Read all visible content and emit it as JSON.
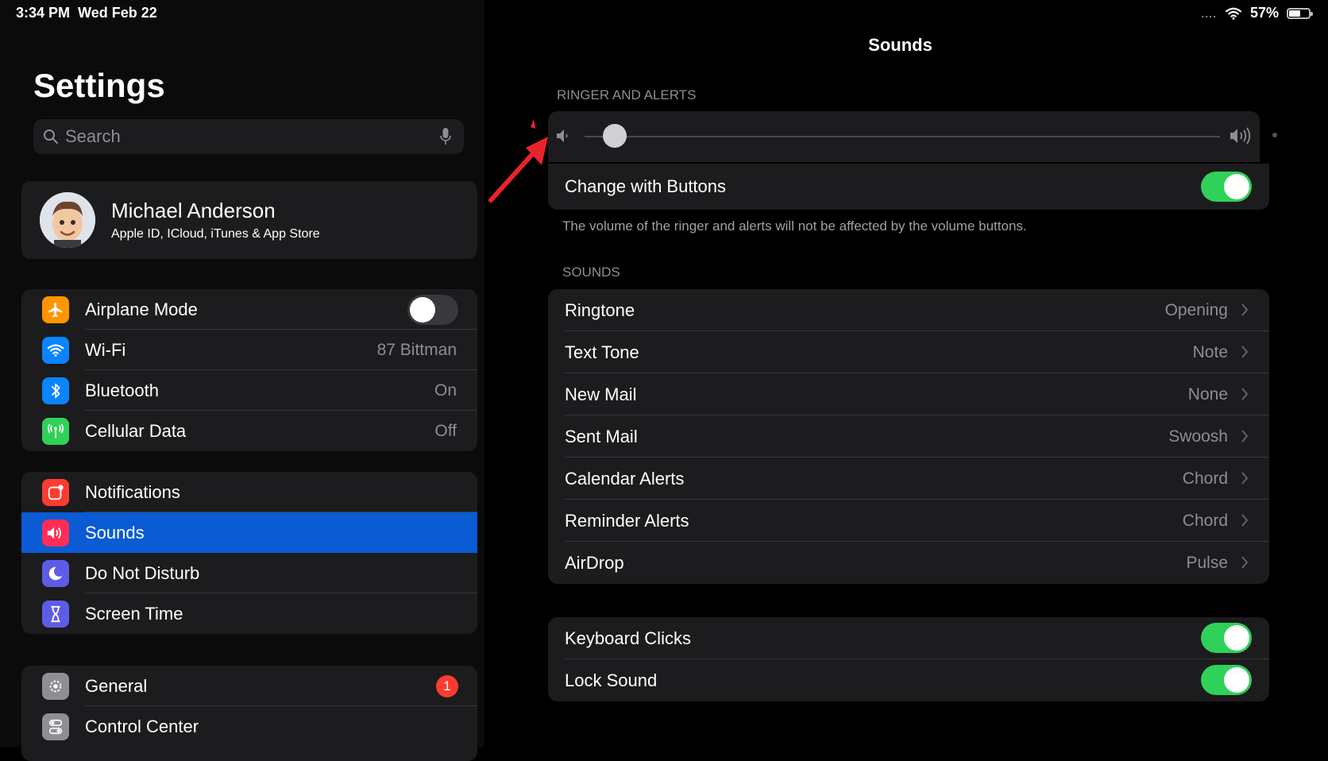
{
  "status_bar": {
    "time": "3:34 PM",
    "date": "Wed Feb 22",
    "dots": "....",
    "battery": "57%",
    "battery_level": 0.57
  },
  "sidebar": {
    "title": "Settings",
    "search_placeholder": "Search",
    "profile": {
      "name": "Michael Anderson",
      "subtitle": "Apple ID, ICloud, iTunes & App Store"
    },
    "group1": [
      {
        "label": "Airplane Mode",
        "icon": "airplane-icon",
        "color": "#ff9500",
        "toggle": false
      },
      {
        "label": "Wi-Fi",
        "value": "87 Bittman",
        "icon": "wifi-icon",
        "color": "#0a84ff"
      },
      {
        "label": "Bluetooth",
        "value": "On",
        "icon": "bluetooth-icon",
        "color": "#0a84ff"
      },
      {
        "label": "Cellular Data",
        "value": "Off",
        "icon": "antenna-icon",
        "color": "#30d158"
      }
    ],
    "group2": [
      {
        "label": "Notifications",
        "icon": "notifications-icon",
        "color": "#ff3b30"
      },
      {
        "label": "Sounds",
        "icon": "speaker-icon",
        "color": "#ff2d55",
        "selected": true
      },
      {
        "label": "Do Not Disturb",
        "icon": "moon-icon",
        "color": "#5e5ce6"
      },
      {
        "label": "Screen Time",
        "icon": "hourglass-icon",
        "color": "#5e5ce6"
      }
    ],
    "group3": [
      {
        "label": "General",
        "icon": "gear-icon",
        "color": "#8e8e93",
        "badge": "1"
      },
      {
        "label": "Control Center",
        "icon": "switches-icon",
        "color": "#8e8e93"
      }
    ]
  },
  "detail": {
    "title": "Sounds",
    "ringer_header": "RINGER AND ALERTS",
    "ringer_volume": 0.05,
    "change_with_buttons": {
      "label": "Change with Buttons",
      "on": true
    },
    "footnote": "The volume of the ringer and alerts will not be affected by the volume buttons.",
    "sounds_header": "SOUNDS",
    "sounds": [
      {
        "label": "Ringtone",
        "value": "Opening"
      },
      {
        "label": "Text Tone",
        "value": "Note"
      },
      {
        "label": "New Mail",
        "value": "None"
      },
      {
        "label": "Sent Mail",
        "value": "Swoosh"
      },
      {
        "label": "Calendar Alerts",
        "value": "Chord"
      },
      {
        "label": "Reminder Alerts",
        "value": "Chord"
      },
      {
        "label": "AirDrop",
        "value": "Pulse"
      }
    ],
    "toggles": [
      {
        "label": "Keyboard Clicks",
        "on": true
      },
      {
        "label": "Lock Sound",
        "on": true
      }
    ]
  },
  "colors": {
    "accent": "#0a5bd4",
    "toggle_on": "#30d158",
    "annotation": "#e8242a"
  }
}
